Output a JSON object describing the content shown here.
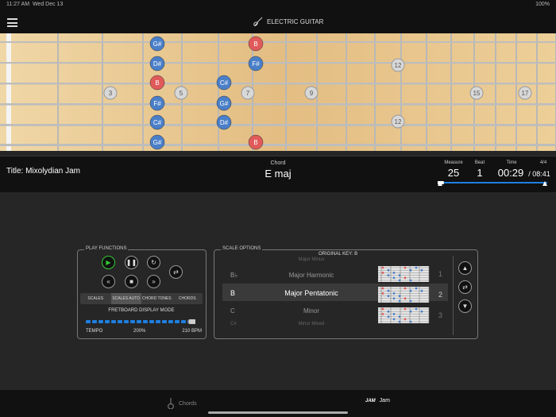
{
  "status": {
    "time": "11:27 AM",
    "date": "Wed Dec 13",
    "battery": "100%"
  },
  "nav": {
    "title": "ELECTRIC GUITAR",
    "menu_icon": "hamburger-icon",
    "guitar_icon": "guitar-icon"
  },
  "fret_markers": [
    "3",
    "5",
    "7",
    "9",
    "12",
    "12",
    "15",
    "17"
  ],
  "notes": [
    {
      "label": "G#",
      "color": "#4a7fc8"
    },
    {
      "label": "B",
      "color": "#e05a5a"
    },
    {
      "label": "D#",
      "color": "#4a7fc8"
    },
    {
      "label": "F#",
      "color": "#4a7fc8"
    },
    {
      "label": "B",
      "color": "#e05a5a"
    },
    {
      "label": "C#",
      "color": "#4a7fc8"
    },
    {
      "label": "F#",
      "color": "#4a7fc8"
    },
    {
      "label": "G#",
      "color": "#4a7fc8"
    },
    {
      "label": "C#",
      "color": "#4a7fc8"
    },
    {
      "label": "D#",
      "color": "#4a7fc8"
    },
    {
      "label": "G#",
      "color": "#4a7fc8"
    },
    {
      "label": "B",
      "color": "#e05a5a"
    }
  ],
  "song": {
    "title": "Title:  Mixolydian Jam",
    "chord_label": "Chord",
    "chord": "E maj",
    "measure_label": "Measure",
    "measure": "25",
    "beat_label": "Beat",
    "beat": "1",
    "time_label": "Time",
    "time": "00:29",
    "time_sig": "4/4",
    "total": "/ 08:41",
    "progress": 0.056
  },
  "play": {
    "legend": "PLAY FUNCTIONS",
    "modes": [
      "SCALES",
      "SCALES AUTO",
      "CHORD TONES",
      "CHORDS"
    ],
    "selected_mode": 1,
    "display_mode": "FRETBOARD DISPLAY MODE",
    "tempo_label": "TEMPO",
    "tempo_pct": "200%",
    "bpm": "210 BPM",
    "tempo_level": 1.0
  },
  "scale": {
    "legend": "SCALE OPTIONS",
    "original_key": "ORIGINAL KEY:   B",
    "rows": [
      {
        "key": "",
        "name": "Major Minus",
        "num": ""
      },
      {
        "key": "B♭",
        "name": "Major Harmonic",
        "num": "1"
      },
      {
        "key": "B",
        "name": "Major Pentatonic",
        "num": "2"
      },
      {
        "key": "C",
        "name": "Minor",
        "num": "3"
      },
      {
        "key": "C#",
        "name": "Minor Mixed",
        "num": ""
      }
    ]
  },
  "tabs": [
    {
      "label": "Chords",
      "icon": "guitar-icon",
      "active": false
    },
    {
      "label": "Jam",
      "icon": "jam-icon",
      "active": true
    }
  ],
  "colors": {
    "accent": "#1e7fe0",
    "root": "#e05a5a",
    "note": "#4a7fc8",
    "wood": "#e9c98f"
  }
}
